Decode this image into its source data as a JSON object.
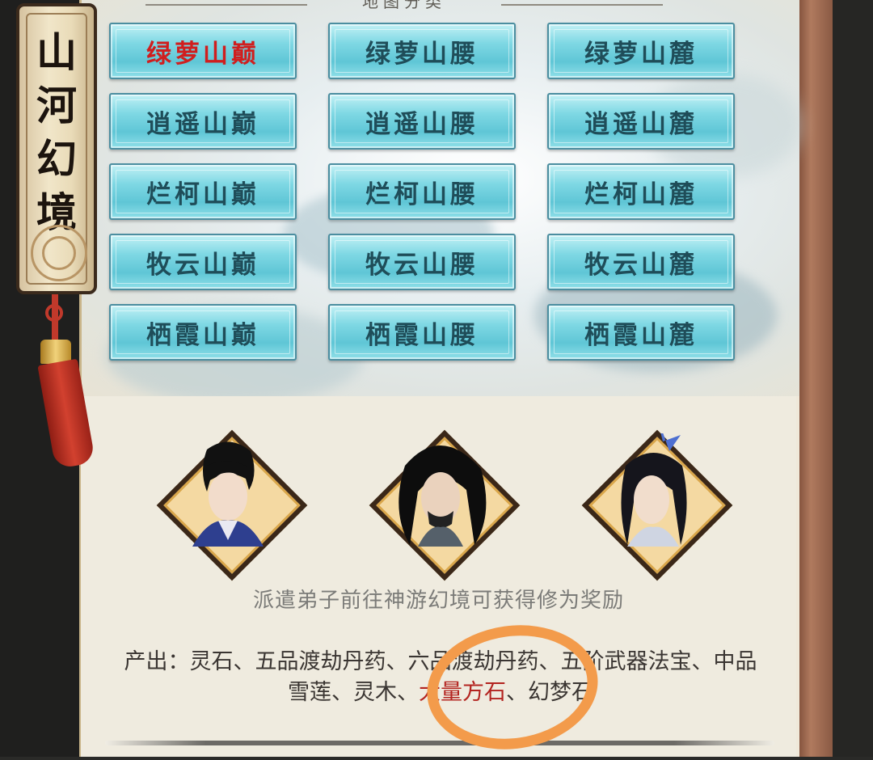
{
  "header": {
    "ornament_title": "地图分类"
  },
  "side_tag": {
    "title": "山河幻境"
  },
  "locations": [
    {
      "label": "绿萝山巅",
      "selected": true
    },
    {
      "label": "绿萝山腰",
      "selected": false
    },
    {
      "label": "绿萝山麓",
      "selected": false
    },
    {
      "label": "逍遥山巅",
      "selected": false
    },
    {
      "label": "逍遥山腰",
      "selected": false
    },
    {
      "label": "逍遥山麓",
      "selected": false
    },
    {
      "label": "烂柯山巅",
      "selected": false
    },
    {
      "label": "烂柯山腰",
      "selected": false
    },
    {
      "label": "烂柯山麓",
      "selected": false
    },
    {
      "label": "牧云山巅",
      "selected": false
    },
    {
      "label": "牧云山腰",
      "selected": false
    },
    {
      "label": "牧云山麓",
      "selected": false
    },
    {
      "label": "栖霞山巅",
      "selected": false
    },
    {
      "label": "栖霞山腰",
      "selected": false
    },
    {
      "label": "栖霞山麓",
      "selected": false
    }
  ],
  "disciples": [
    {
      "icon": "disciple-portrait-1"
    },
    {
      "icon": "disciple-portrait-2"
    },
    {
      "icon": "disciple-portrait-3"
    }
  ],
  "description": "派遣弟子前往神游幻境可获得修为奖励",
  "output": {
    "prefix": "产出：灵石、五品渡劫丹药、六品渡劫丹药、五阶武器法宝、中品雪莲、灵木、",
    "highlight": "大量方石",
    "suffix": "、幻梦石"
  },
  "colors": {
    "button_text": "#1f4d59",
    "selected_text": "#d01e1e",
    "highlight_text": "#b3231f",
    "annotation_ring": "#f39b4b"
  }
}
